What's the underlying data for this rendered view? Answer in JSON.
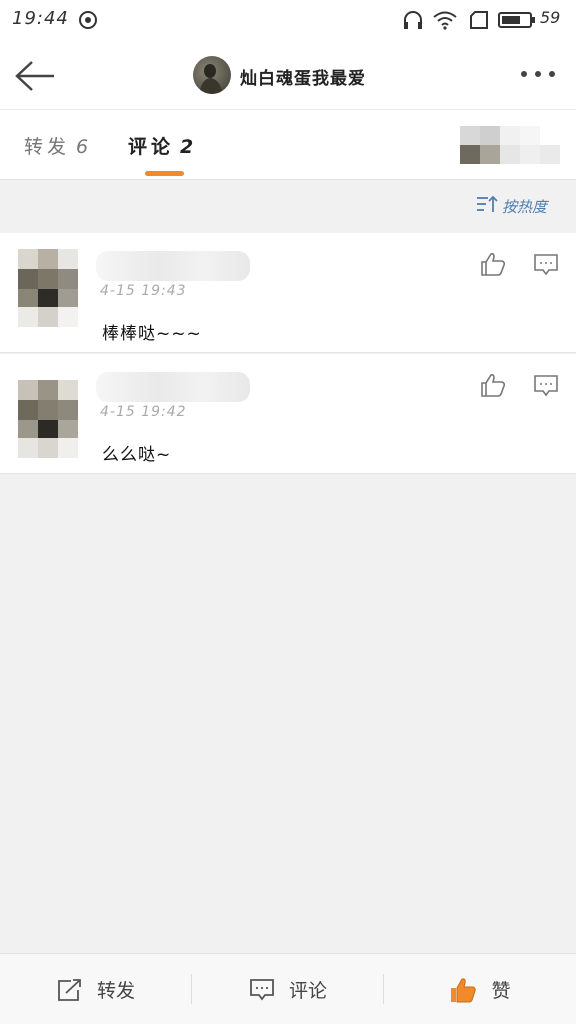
{
  "status_bar": {
    "time": "19:44",
    "battery": "59"
  },
  "nav": {
    "title": "灿白魂蛋我最爱"
  },
  "tabs": [
    {
      "label": "转发",
      "count": "6"
    },
    {
      "label": "评论",
      "count": "2"
    }
  ],
  "sort": {
    "label": "按热度"
  },
  "comments": [
    {
      "time": "4-15 19:43",
      "text": "棒棒哒~~~"
    },
    {
      "time": "4-15 19:42",
      "text": "么么哒~"
    }
  ],
  "bottom": {
    "forward": "转发",
    "comment": "评论",
    "like": "赞"
  },
  "colors": {
    "accent": "#f08a2a",
    "link": "#4f7fb2",
    "like_icon": "#f08a2a"
  }
}
